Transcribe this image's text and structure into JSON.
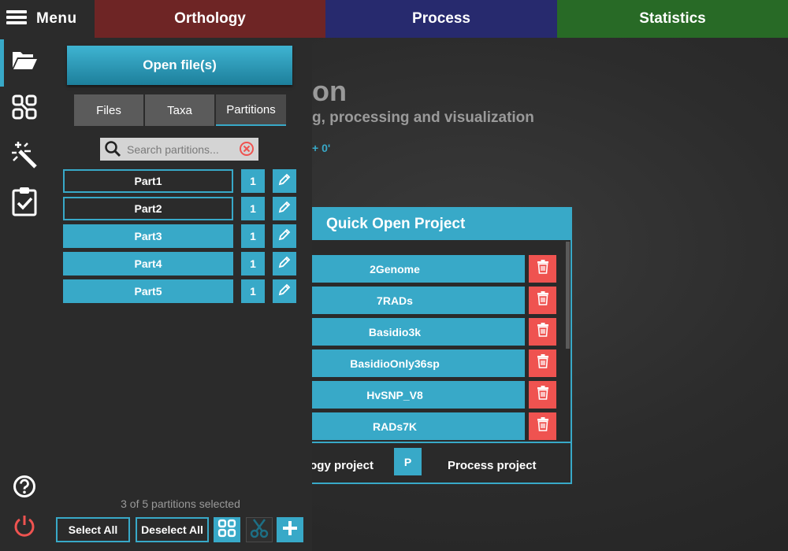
{
  "colors": {
    "accent": "#38a9c8",
    "orthology": "#6e2525",
    "process": "#272a6e",
    "statistics": "#286a26",
    "danger": "#ef5350"
  },
  "header": {
    "menu_label": "Menu",
    "tabs": [
      {
        "label": "Orthology",
        "color": "#6e2525"
      },
      {
        "label": "Process",
        "color": "#272a6e"
      },
      {
        "label": "Statistics",
        "color": "#286a26"
      }
    ]
  },
  "rail": {
    "items": [
      {
        "icon": "folder-open-icon",
        "active": true
      },
      {
        "icon": "partitions-icon",
        "active": false
      },
      {
        "icon": "magic-wand-icon",
        "active": false
      },
      {
        "icon": "clipboard-check-icon",
        "active": false
      },
      {
        "icon": "help-icon",
        "active": false
      },
      {
        "icon": "power-icon",
        "active": false
      }
    ]
  },
  "background": {
    "title_fragment": "on",
    "subtitle_fragment": "g, processing and visualization",
    "version_fragment": "+ 0'"
  },
  "panel": {
    "open_button": "Open file(s)",
    "tabs": [
      "Files",
      "Taxa",
      "Partitions"
    ],
    "active_tab": "Partitions",
    "search": {
      "placeholder": "Search partitions...",
      "value": ""
    },
    "partitions": [
      {
        "name": "Part1",
        "count": "1",
        "selected": false
      },
      {
        "name": "Part2",
        "count": "1",
        "selected": false
      },
      {
        "name": "Part3",
        "count": "1",
        "selected": true
      },
      {
        "name": "Part4",
        "count": "1",
        "selected": true
      },
      {
        "name": "Part5",
        "count": "1",
        "selected": true
      }
    ],
    "status": "3 of 5 partitions selected",
    "select_all": "Select All",
    "deselect_all": "Deselect All"
  },
  "quick_open": {
    "title": "Quick Open Project",
    "projects": [
      "2Genome",
      "7RADs",
      "Basidio3k",
      "BasidioOnly36sp",
      "HvSNP_V8",
      "RADs7K"
    ],
    "footer_orthology": "ogy project",
    "footer_p_badge": "P",
    "footer_process": "Process project"
  }
}
